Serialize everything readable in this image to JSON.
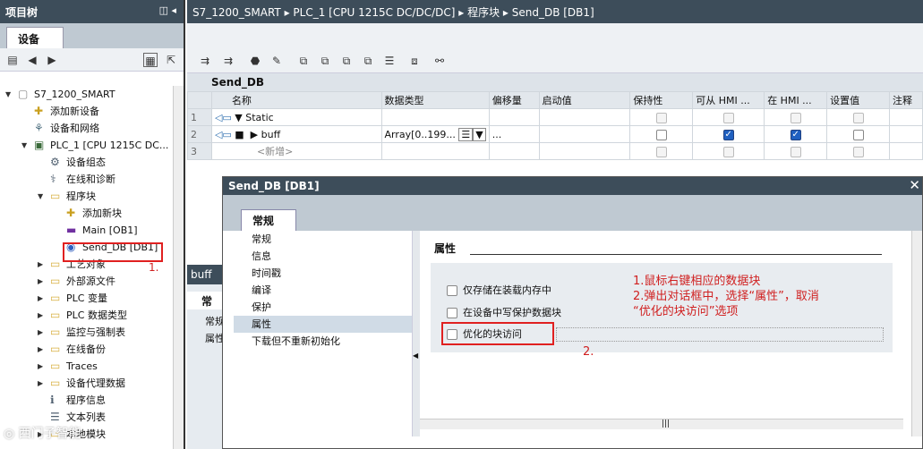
{
  "left": {
    "title": "项目树",
    "tab": "设备",
    "tree": [
      {
        "label": "S7_1200_SMART",
        "level": 0,
        "exp": "▼",
        "icon": "project"
      },
      {
        "label": "添加新设备",
        "level": 1,
        "exp": "",
        "icon": "add"
      },
      {
        "label": "设备和网络",
        "level": 1,
        "exp": "",
        "icon": "net"
      },
      {
        "label": "PLC_1 [CPU 1215C DC...",
        "level": 1,
        "exp": "▼",
        "icon": "plc"
      },
      {
        "label": "设备组态",
        "level": 2,
        "exp": "",
        "icon": "cfg"
      },
      {
        "label": "在线和诊断",
        "level": 2,
        "exp": "",
        "icon": "diag"
      },
      {
        "label": "程序块",
        "level": 2,
        "exp": "▼",
        "icon": "folder"
      },
      {
        "label": "添加新块",
        "level": 3,
        "exp": "",
        "icon": "add"
      },
      {
        "label": "Main [OB1]",
        "level": 3,
        "exp": "",
        "icon": "ob"
      },
      {
        "label": "Send_DB [DB1]",
        "level": 3,
        "exp": "",
        "icon": "db"
      },
      {
        "label": "工艺对象",
        "level": 2,
        "exp": "▶",
        "icon": "folder"
      },
      {
        "label": "外部源文件",
        "level": 2,
        "exp": "▶",
        "icon": "folder"
      },
      {
        "label": "PLC 变量",
        "level": 2,
        "exp": "▶",
        "icon": "folder"
      },
      {
        "label": "PLC 数据类型",
        "level": 2,
        "exp": "▶",
        "icon": "folder"
      },
      {
        "label": "监控与强制表",
        "level": 2,
        "exp": "▶",
        "icon": "folder"
      },
      {
        "label": "在线备份",
        "level": 2,
        "exp": "▶",
        "icon": "folder"
      },
      {
        "label": "Traces",
        "level": 2,
        "exp": "▶",
        "icon": "folder"
      },
      {
        "label": "设备代理数据",
        "level": 2,
        "exp": "▶",
        "icon": "folder"
      },
      {
        "label": "程序信息",
        "level": 2,
        "exp": "",
        "icon": "info"
      },
      {
        "label": "文本列表",
        "level": 2,
        "exp": "",
        "icon": "list"
      },
      {
        "label": "本地模块",
        "level": 2,
        "exp": "▶",
        "icon": "folder"
      }
    ]
  },
  "breadcrumb": "S7_1200_SMART  ▸  PLC_1 [CPU 1215C DC/DC/DC]  ▸  程序块  ▸  Send_DB [DB1]",
  "db_name": "Send_DB",
  "table": {
    "headers": [
      "名称",
      "数据类型",
      "偏移量",
      "启动值",
      "保持性",
      "可从 HMI ...",
      "在 HMI ...",
      "设置值",
      "注释"
    ],
    "rows": [
      {
        "num": "1",
        "name": "Static",
        "type": "",
        "offset": ""
      },
      {
        "num": "2",
        "name": "buff",
        "type": "Array[0..199...",
        "offset": "..."
      },
      {
        "num": "3",
        "name": "<新增>",
        "type": "",
        "offset": ""
      }
    ]
  },
  "side_tab": "buff",
  "side_tab2": "常",
  "side_items": [
    "常规",
    "属性"
  ],
  "dialog": {
    "title": "Send_DB [DB1]",
    "tab": "常规",
    "nav": [
      "常规",
      "信息",
      "时间戳",
      "编译",
      "保护",
      "属性",
      "下载但不重新初始化"
    ],
    "props_title": "属性",
    "options": [
      "仅存储在装载内存中",
      "在设备中写保护数据块",
      "优化的块访问"
    ],
    "note": [
      "1.鼠标右键相应的数据块",
      "2.弹出对话框中，选择“属性”，取消",
      "“优化的块访问”选项"
    ],
    "marker2": "2."
  },
  "marker1": "1.",
  "watermark": "◎ 西门子智能",
  "colors": {
    "titlebar": "#3d4d5a",
    "annotation": "#d02020",
    "highlight": "#e02020"
  }
}
